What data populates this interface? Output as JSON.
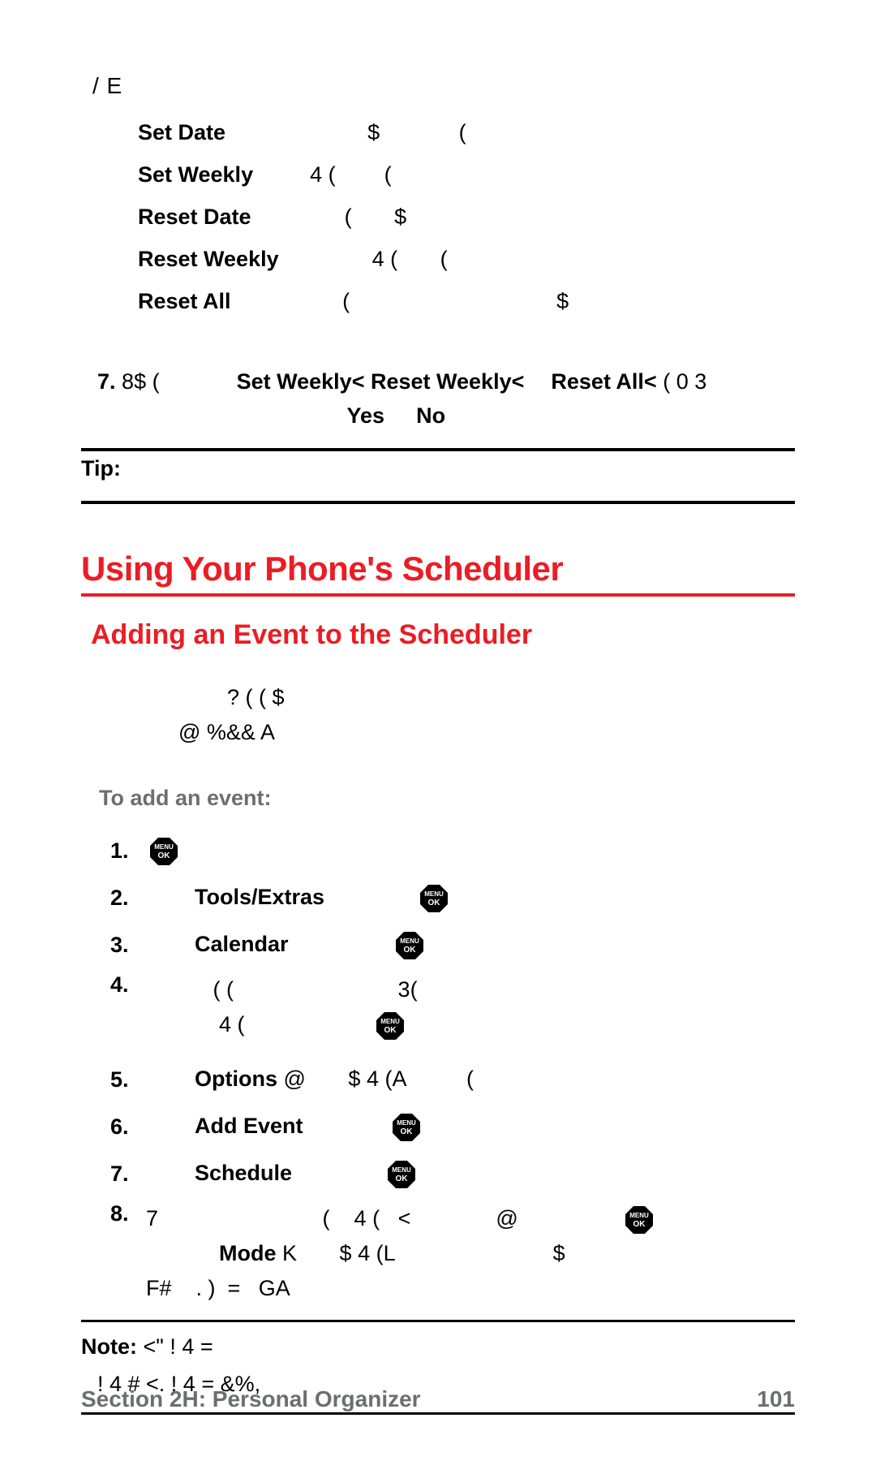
{
  "top_leader": "/     E",
  "options": [
    {
      "label": "Set Date",
      "rest": "                      $             ("
    },
    {
      "label": "Set Weekly",
      "rest": "        4 (        ("
    },
    {
      "label": "Reset Date",
      "rest": "              (       $"
    },
    {
      "label": "Reset Weekly",
      "rest": "              4 (       ("
    },
    {
      "label": "Reset All",
      "rest": "                 (                                  $"
    }
  ],
  "step7": {
    "no": "7.",
    "pre": "  8$ (",
    "b1": "Set Weekly<",
    "b2": "Reset Weekly<",
    "b3": "Reset All<",
    "post": " (  0   3",
    "line2a": "Yes",
    "line2b": "No"
  },
  "tip_label": "Tip:",
  "h1": "Using Your Phone's Scheduler",
  "h2": "Adding an Event to the Scheduler",
  "body_line1": "? (                    (   $",
  "body_line2": "@      %&&       A",
  "lead": "To add an event:",
  "steps": [
    {
      "no": "1.",
      "parts": [
        {
          "t": "icon"
        }
      ]
    },
    {
      "no": "2.",
      "parts": [
        {
          "t": "text",
          "v": "        "
        },
        {
          "t": "bold",
          "v": "Tools/Extras"
        },
        {
          "t": "text",
          "v": "               "
        },
        {
          "t": "icon"
        }
      ]
    },
    {
      "no": "3.",
      "parts": [
        {
          "t": "text",
          "v": "        "
        },
        {
          "t": "bold",
          "v": "Calendar"
        },
        {
          "t": "text",
          "v": "                 "
        },
        {
          "t": "icon"
        }
      ]
    },
    {
      "no": "4.",
      "tall": true,
      "parts": [
        {
          "t": "text",
          "v": "           ( (                           3("
        },
        {
          "t": "br"
        },
        {
          "t": "text",
          "v": "            4 (                     "
        },
        {
          "t": "icon"
        }
      ]
    },
    {
      "no": "5.",
      "parts": [
        {
          "t": "text",
          "v": "        "
        },
        {
          "t": "bold",
          "v": "Options"
        },
        {
          "t": "text",
          "v": " @       $ 4 (A          ("
        }
      ]
    },
    {
      "no": "6.",
      "parts": [
        {
          "t": "text",
          "v": "        "
        },
        {
          "t": "bold",
          "v": "Add Event"
        },
        {
          "t": "text",
          "v": "              "
        },
        {
          "t": "icon"
        }
      ]
    },
    {
      "no": "7.",
      "parts": [
        {
          "t": "text",
          "v": "        "
        },
        {
          "t": "bold",
          "v": "Schedule"
        },
        {
          "t": "text",
          "v": "               "
        },
        {
          "t": "icon"
        }
      ]
    },
    {
      "no": "8.",
      "tall": true,
      "parts": [
        {
          "t": "text",
          "v": "7                           (    4 (   <              @                 "
        },
        {
          "t": "icon"
        },
        {
          "t": "br"
        },
        {
          "t": "text",
          "v": "            "
        },
        {
          "t": "bold",
          "v": "Mode"
        },
        {
          "t": "text",
          "v": " K       $ 4 (L                          $"
        },
        {
          "t": "br"
        },
        {
          "t": "text",
          "v": "F#    . )  =   GA"
        }
      ]
    }
  ],
  "note": {
    "label": "Note:",
    "l1": "   <\"      !  4     =",
    "l2": "!  4     #   <.        !  4        =       &%,"
  },
  "footer_left": "Section 2H: Personal Organizer",
  "footer_right": "101"
}
